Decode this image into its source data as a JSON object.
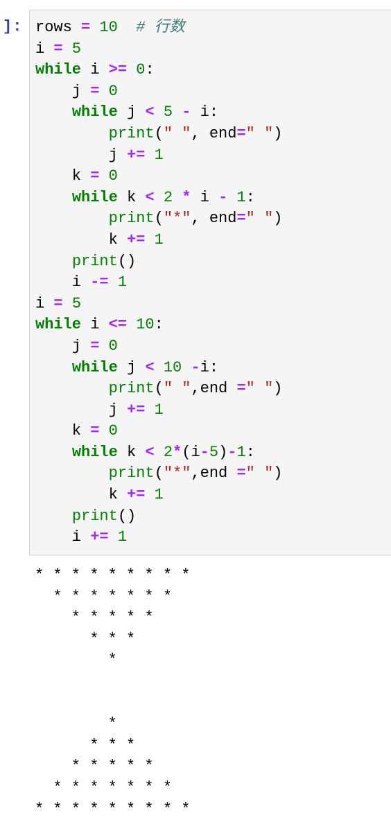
{
  "cell": {
    "prompt": "]:",
    "code_lines": [
      [
        {
          "t": "rows ",
          "c": ""
        },
        {
          "t": "=",
          "c": "op"
        },
        {
          "t": " ",
          "c": ""
        },
        {
          "t": "10",
          "c": "num"
        },
        {
          "t": "  ",
          "c": ""
        },
        {
          "t": "# 行数",
          "c": "cm"
        }
      ],
      [
        {
          "t": "i ",
          "c": ""
        },
        {
          "t": "=",
          "c": "op"
        },
        {
          "t": " ",
          "c": ""
        },
        {
          "t": "5",
          "c": "num"
        }
      ],
      [
        {
          "t": "while",
          "c": "kw"
        },
        {
          "t": " i ",
          "c": ""
        },
        {
          "t": ">=",
          "c": "op"
        },
        {
          "t": " ",
          "c": ""
        },
        {
          "t": "0",
          "c": "num"
        },
        {
          "t": ":",
          "c": ""
        }
      ],
      [
        {
          "t": "    j ",
          "c": ""
        },
        {
          "t": "=",
          "c": "op"
        },
        {
          "t": " ",
          "c": ""
        },
        {
          "t": "0",
          "c": "num"
        }
      ],
      [
        {
          "t": "    ",
          "c": ""
        },
        {
          "t": "while",
          "c": "kw"
        },
        {
          "t": " j ",
          "c": ""
        },
        {
          "t": "<",
          "c": "op"
        },
        {
          "t": " ",
          "c": ""
        },
        {
          "t": "5",
          "c": "num"
        },
        {
          "t": " ",
          "c": ""
        },
        {
          "t": "-",
          "c": "op"
        },
        {
          "t": " i:",
          "c": ""
        }
      ],
      [
        {
          "t": "        ",
          "c": ""
        },
        {
          "t": "print",
          "c": "bi"
        },
        {
          "t": "(",
          "c": ""
        },
        {
          "t": "\" \"",
          "c": "str"
        },
        {
          "t": ", end",
          "c": ""
        },
        {
          "t": "=",
          "c": "op"
        },
        {
          "t": "\" \"",
          "c": "str"
        },
        {
          "t": ")",
          "c": ""
        }
      ],
      [
        {
          "t": "        j ",
          "c": ""
        },
        {
          "t": "+=",
          "c": "op"
        },
        {
          "t": " ",
          "c": ""
        },
        {
          "t": "1",
          "c": "num"
        }
      ],
      [
        {
          "t": "    k ",
          "c": ""
        },
        {
          "t": "=",
          "c": "op"
        },
        {
          "t": " ",
          "c": ""
        },
        {
          "t": "0",
          "c": "num"
        }
      ],
      [
        {
          "t": "    ",
          "c": ""
        },
        {
          "t": "while",
          "c": "kw"
        },
        {
          "t": " k ",
          "c": ""
        },
        {
          "t": "<",
          "c": "op"
        },
        {
          "t": " ",
          "c": ""
        },
        {
          "t": "2",
          "c": "num"
        },
        {
          "t": " ",
          "c": ""
        },
        {
          "t": "*",
          "c": "op"
        },
        {
          "t": " i ",
          "c": ""
        },
        {
          "t": "-",
          "c": "op"
        },
        {
          "t": " ",
          "c": ""
        },
        {
          "t": "1",
          "c": "num"
        },
        {
          "t": ":",
          "c": ""
        }
      ],
      [
        {
          "t": "        ",
          "c": ""
        },
        {
          "t": "print",
          "c": "bi"
        },
        {
          "t": "(",
          "c": ""
        },
        {
          "t": "\"*\"",
          "c": "str"
        },
        {
          "t": ", end",
          "c": ""
        },
        {
          "t": "=",
          "c": "op"
        },
        {
          "t": "\" \"",
          "c": "str"
        },
        {
          "t": ")",
          "c": ""
        }
      ],
      [
        {
          "t": "        k ",
          "c": ""
        },
        {
          "t": "+=",
          "c": "op"
        },
        {
          "t": " ",
          "c": ""
        },
        {
          "t": "1",
          "c": "num"
        }
      ],
      [
        {
          "t": "    ",
          "c": ""
        },
        {
          "t": "print",
          "c": "bi"
        },
        {
          "t": "()",
          "c": ""
        }
      ],
      [
        {
          "t": "    i ",
          "c": ""
        },
        {
          "t": "-=",
          "c": "op"
        },
        {
          "t": " ",
          "c": ""
        },
        {
          "t": "1",
          "c": "num"
        }
      ],
      [
        {
          "t": "i ",
          "c": ""
        },
        {
          "t": "=",
          "c": "op"
        },
        {
          "t": " ",
          "c": ""
        },
        {
          "t": "5",
          "c": "num"
        }
      ],
      [
        {
          "t": "while",
          "c": "kw"
        },
        {
          "t": " i ",
          "c": ""
        },
        {
          "t": "<=",
          "c": "op"
        },
        {
          "t": " ",
          "c": ""
        },
        {
          "t": "10",
          "c": "num"
        },
        {
          "t": ":",
          "c": ""
        }
      ],
      [
        {
          "t": "    j ",
          "c": ""
        },
        {
          "t": "=",
          "c": "op"
        },
        {
          "t": " ",
          "c": ""
        },
        {
          "t": "0",
          "c": "num"
        }
      ],
      [
        {
          "t": "    ",
          "c": ""
        },
        {
          "t": "while",
          "c": "kw"
        },
        {
          "t": " j ",
          "c": ""
        },
        {
          "t": "<",
          "c": "op"
        },
        {
          "t": " ",
          "c": ""
        },
        {
          "t": "10",
          "c": "num"
        },
        {
          "t": " ",
          "c": ""
        },
        {
          "t": "-",
          "c": "op"
        },
        {
          "t": "i:",
          "c": ""
        }
      ],
      [
        {
          "t": "        ",
          "c": ""
        },
        {
          "t": "print",
          "c": "bi"
        },
        {
          "t": "(",
          "c": ""
        },
        {
          "t": "\" \"",
          "c": "str"
        },
        {
          "t": ",end ",
          "c": ""
        },
        {
          "t": "=",
          "c": "op"
        },
        {
          "t": "\" \"",
          "c": "str"
        },
        {
          "t": ")",
          "c": ""
        }
      ],
      [
        {
          "t": "        j ",
          "c": ""
        },
        {
          "t": "+=",
          "c": "op"
        },
        {
          "t": " ",
          "c": ""
        },
        {
          "t": "1",
          "c": "num"
        }
      ],
      [
        {
          "t": "    k ",
          "c": ""
        },
        {
          "t": "=",
          "c": "op"
        },
        {
          "t": " ",
          "c": ""
        },
        {
          "t": "0",
          "c": "num"
        }
      ],
      [
        {
          "t": "    ",
          "c": ""
        },
        {
          "t": "while",
          "c": "kw"
        },
        {
          "t": " k ",
          "c": ""
        },
        {
          "t": "<",
          "c": "op"
        },
        {
          "t": " ",
          "c": ""
        },
        {
          "t": "2",
          "c": "num"
        },
        {
          "t": "*",
          "c": "op"
        },
        {
          "t": "(i",
          "c": ""
        },
        {
          "t": "-",
          "c": "op"
        },
        {
          "t": "5",
          "c": "num"
        },
        {
          "t": ")",
          "c": ""
        },
        {
          "t": "-",
          "c": "op"
        },
        {
          "t": "1",
          "c": "num"
        },
        {
          "t": ":",
          "c": ""
        }
      ],
      [
        {
          "t": "        ",
          "c": ""
        },
        {
          "t": "print",
          "c": "bi"
        },
        {
          "t": "(",
          "c": ""
        },
        {
          "t": "\"*\"",
          "c": "str"
        },
        {
          "t": ",end ",
          "c": ""
        },
        {
          "t": "=",
          "c": "op"
        },
        {
          "t": "\" \"",
          "c": "str"
        },
        {
          "t": ")",
          "c": ""
        }
      ],
      [
        {
          "t": "        k ",
          "c": ""
        },
        {
          "t": "+=",
          "c": "op"
        },
        {
          "t": " ",
          "c": ""
        },
        {
          "t": "1",
          "c": "num"
        }
      ],
      [
        {
          "t": "    ",
          "c": ""
        },
        {
          "t": "print",
          "c": "bi"
        },
        {
          "t": "()",
          "c": ""
        }
      ],
      [
        {
          "t": "    i ",
          "c": ""
        },
        {
          "t": "+=",
          "c": "op"
        },
        {
          "t": " ",
          "c": ""
        },
        {
          "t": "1",
          "c": "num"
        }
      ]
    ]
  },
  "output": {
    "lines": [
      "* * * * * * * * *",
      "  * * * * * * *",
      "    * * * * *",
      "      * * *",
      "        *",
      "",
      "",
      "        *",
      "      * * *",
      "    * * * * *",
      "  * * * * * * *",
      "* * * * * * * * *"
    ]
  },
  "colors": {
    "keyword": "#008000",
    "operator": "#aa22ff",
    "number": "#008000",
    "string": "#ba2121",
    "comment": "#3d7b7b",
    "prompt": "#303f9f",
    "cell_background": "#f5f5f5",
    "cell_border": "#cfcfcf"
  }
}
